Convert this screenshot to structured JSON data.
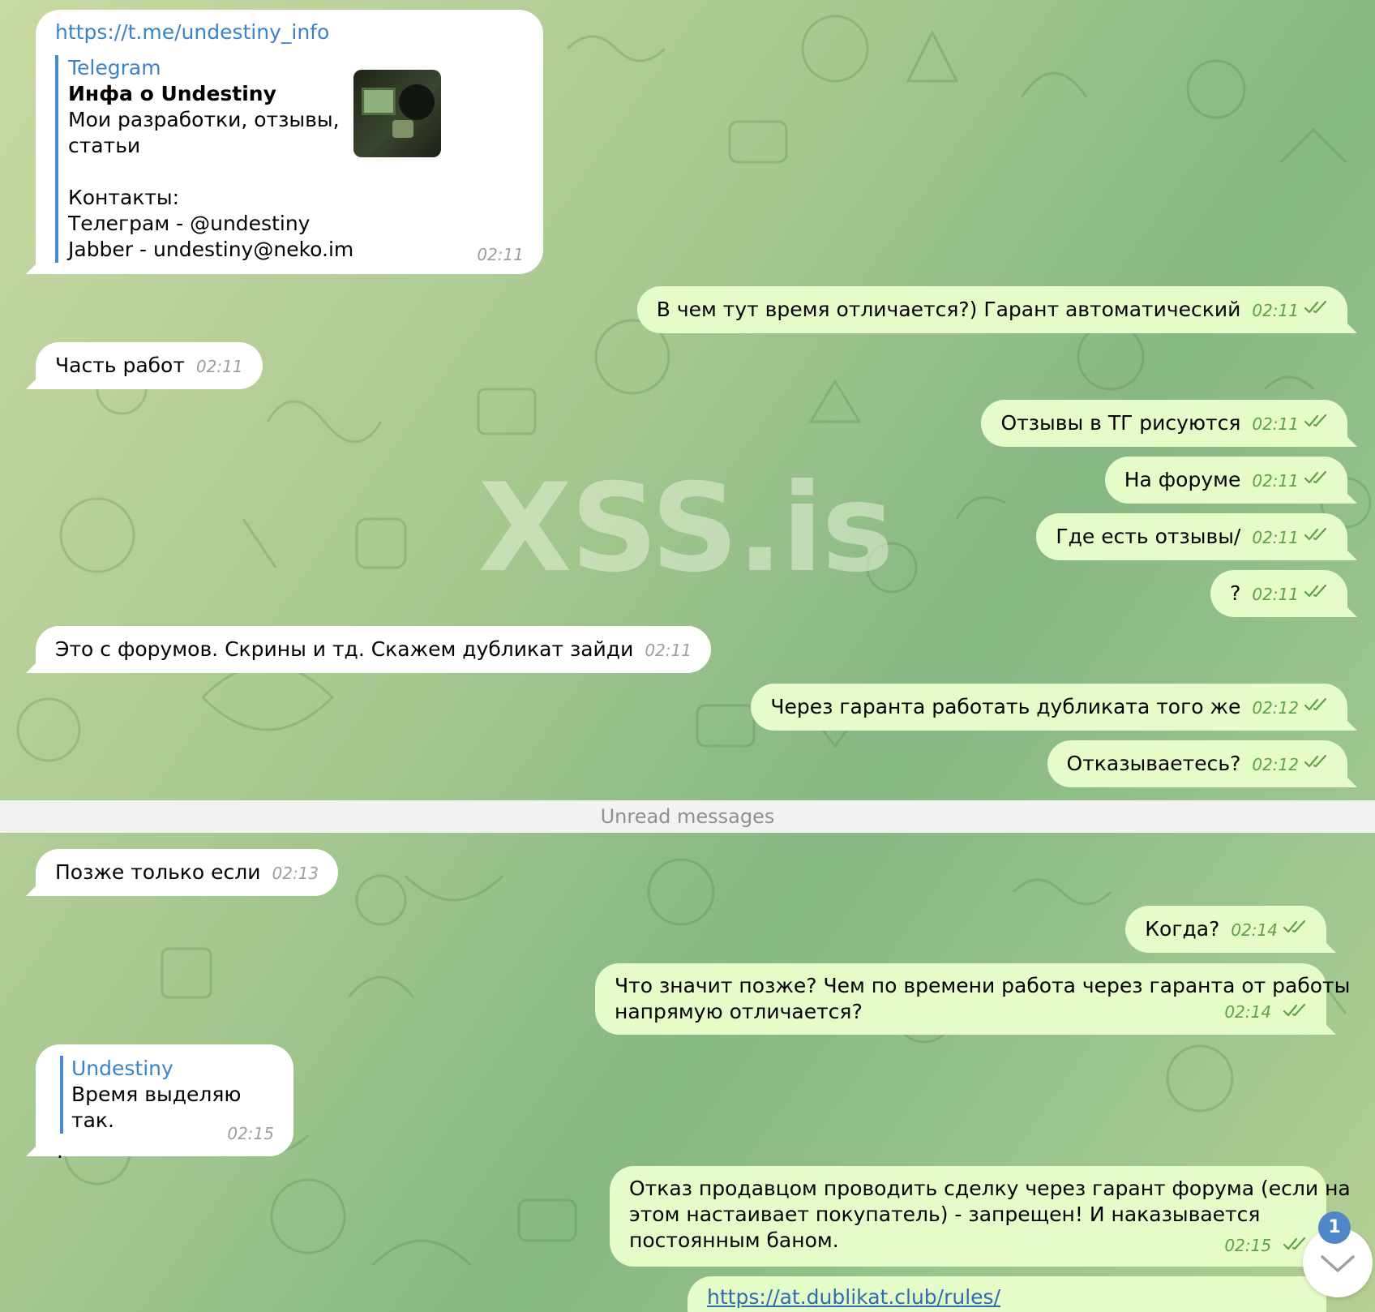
{
  "watermark": "XSS.is",
  "divider_label": "Unread messages",
  "unread_count": "1",
  "messages": [
    {
      "url": "https://t.me/undestiny_info",
      "preview": {
        "site": "Telegram",
        "title": "Инфа о Undestiny",
        "description": "Мои разработки, отзывы, статьи",
        "lines": [
          "Контакты:",
          "Телеграм - @undestiny",
          "Jabber - undestiny@neko.im"
        ]
      },
      "time": "02:11"
    },
    {
      "text": "В чем тут время отличается?) Гарант автоматический",
      "time": "02:11"
    },
    {
      "text": "Часть работ",
      "time": "02:11"
    },
    {
      "text": "Отзывы в ТГ рисуются",
      "time": "02:11"
    },
    {
      "text": "На форуме",
      "time": "02:11"
    },
    {
      "text": "Где есть отзывы/",
      "time": "02:11"
    },
    {
      "text": "?",
      "time": "02:11"
    },
    {
      "text": "Это с форумов. Скрины и тд. Скажем дубликат зайди",
      "time": "02:11"
    },
    {
      "text": "Через гаранта работать дубликата того же",
      "time": "02:12"
    },
    {
      "text": "Отказываетесь?",
      "time": "02:12"
    },
    {
      "text": "Позже только если",
      "time": "02:13"
    },
    {
      "text": "Когда?",
      "time": "02:14"
    },
    {
      "lines": [
        "Что значит позже? Чем по времени работа через гаранта от работы",
        "напрямую отличается?"
      ],
      "time": "02:14"
    },
    {
      "quote_author": "Undestiny",
      "quote_text": "Время выделяю так.",
      "text": ".",
      "time": "02:15"
    },
    {
      "lines": [
        "Отказ продавцом проводить сделку через гарант форума (если на",
        "этом настаивает покупатель) - запрещен! И наказывается",
        "постоянным баном."
      ],
      "time": "02:15"
    },
    {
      "link": "https://at.dublikat.club/rules/"
    }
  ]
}
